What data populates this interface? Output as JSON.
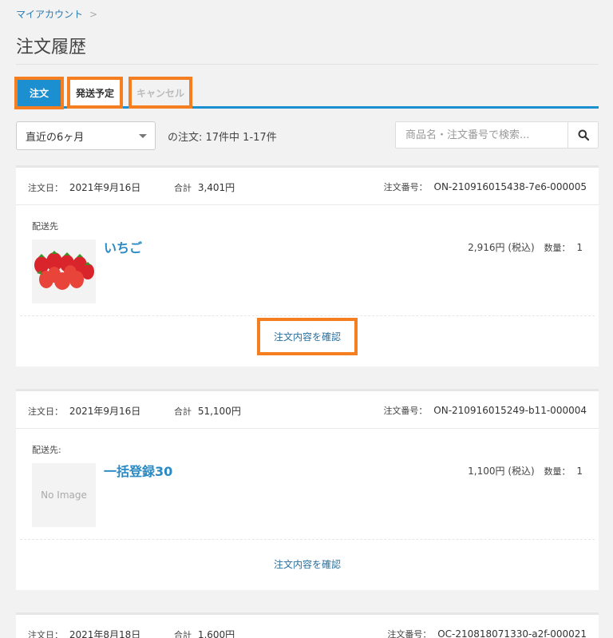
{
  "breadcrumb": {
    "my_account": "マイアカウント",
    "separator": ">"
  },
  "page_title": "注文履歴",
  "tabs": [
    {
      "label": "注文",
      "active": true
    },
    {
      "label": "発送予定",
      "active": false
    },
    {
      "label": "キャンセル",
      "active": false
    }
  ],
  "filter": {
    "period_selected": "直近の6ヶ月",
    "order_count": "の注文: 17件中 1-17件",
    "search_placeholder": "商品名・注文番号で検索..."
  },
  "labels": {
    "order_date": "注文日：",
    "total": "合計",
    "order_number": "注文番号：",
    "quantity": "数量：",
    "confirm": "注文内容を確認"
  },
  "orders": [
    {
      "date": "2021年9月16日",
      "total": "3,401円",
      "number": "ON-210916015438-7e6-000005",
      "ship_label": "配送先",
      "item": {
        "name": "いちご",
        "price": "2,916円 (税込)",
        "qty": "1",
        "image": "strawberry-image",
        "no_image_text": ""
      }
    },
    {
      "date": "2021年9月16日",
      "total": "51,100円",
      "number": "ON-210916015249-b11-000004",
      "ship_label": "配送先:",
      "item": {
        "name": "一括登録30",
        "price": "1,100円 (税込)",
        "qty": "1",
        "image": "no-image",
        "no_image_text": "No Image"
      }
    },
    {
      "date": "2021年8月18日",
      "total": "1,600円",
      "number": "OC-210818071330-a2f-000021"
    }
  ],
  "colors": {
    "accent": "#1c8fd0",
    "highlight": "#f47e20",
    "link": "#2a8ac4"
  }
}
